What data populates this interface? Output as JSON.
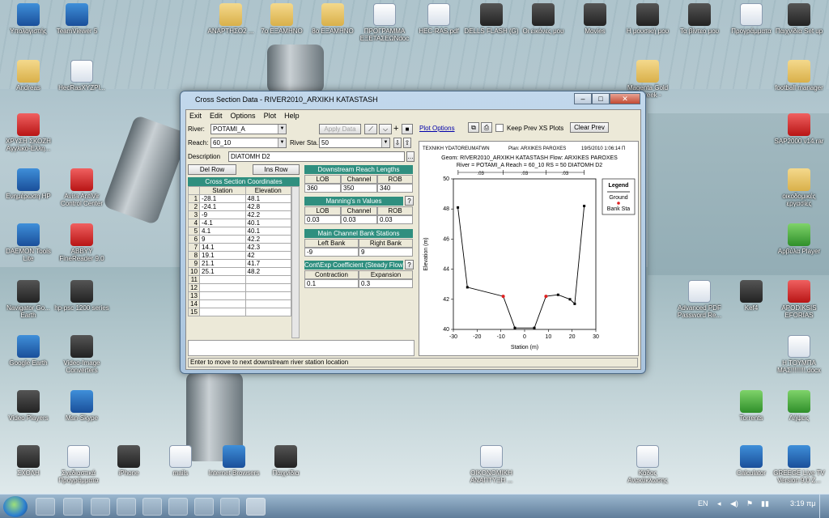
{
  "desktop": {
    "icons": [
      {
        "label": "Υπολογιστής"
      },
      {
        "label": "TeamViewer 5"
      },
      {
        "label": "ΑΝΑΡΤΗΣΟ2 ..."
      },
      {
        "label": "7ο ΕΞΑΜΗΝΟ"
      },
      {
        "label": "8ο ΕΞΑΜΗΝΟ"
      },
      {
        "label": "ΠΡΟΓΡΑΜΜΑ ΕΞΕΤΑΣΕΩΝdoc"
      },
      {
        "label": "HEC-RAS.pdf"
      },
      {
        "label": "DELLS FLASH (G)"
      },
      {
        "label": "Οι εικόνες μου"
      },
      {
        "label": "Movies"
      },
      {
        "label": "Η μουσική μου"
      },
      {
        "label": "Τα βίντεο μου"
      },
      {
        "label": "Προγράμματα"
      },
      {
        "label": "Παιχνίδια Set up"
      },
      {
        "label": "Andreas"
      },
      {
        "label": "HecRasXYZPl..."
      },
      {
        "label": "ΧΡΥΣΗ ΣΚΟΖΗ Αγγλικό-Ελλη..."
      },
      {
        "label": "Ενημέρωση HP"
      },
      {
        "label": "Avira AntiVir Control Center"
      },
      {
        "label": "DAEMON Tools Lite"
      },
      {
        "label": "ABBYY FineReader 9.0"
      },
      {
        "label": "Navigator Go... Earth"
      },
      {
        "label": "hp-psc 1200 series"
      },
      {
        "label": "Google Earth"
      },
      {
        "label": "Video-Image Converters"
      },
      {
        "label": "Video Players"
      },
      {
        "label": "Msn-Skype"
      },
      {
        "label": "ΣΧΟΛΗ"
      },
      {
        "label": "Σχεδιαστικά Προγράμματα"
      },
      {
        "label": "iPhone"
      },
      {
        "label": "mails"
      },
      {
        "label": "Internet Browsers"
      },
      {
        "label": "Παιχνίδια"
      },
      {
        "label": "ΟΙΚΟΝΟΜΙΚΗ ΑΝΑΠΤΥΞΗ ..."
      },
      {
        "label": "Κάδος Ανακύκλωσης"
      },
      {
        "label": "Calculator"
      },
      {
        "label": "GREEGE Live TV Version 9.0 Z..."
      },
      {
        "label": "football manager"
      },
      {
        "label": "SAP2000 v14.rar"
      },
      {
        "label": "οικοδομικές εργασίες"
      },
      {
        "label": "Αρβύλα Player"
      },
      {
        "label": "Advanced PDF Password Re..."
      },
      {
        "label": "Kef4"
      },
      {
        "label": "APODIKSIS EFORIAS"
      },
      {
        "label": "Η ΤΟΥΜΠΑ ΜΑΣ!!!!!!!!.docx"
      },
      {
        "label": "Torrents"
      },
      {
        "label": "Λήψεις"
      },
      {
        "label": "Magenta Gold ...Greek -"
      }
    ]
  },
  "window": {
    "title": "Cross Section Data - RIVER2010_ARXIKH KATASTASH",
    "menu": [
      "Exit",
      "Edit",
      "Options",
      "Plot",
      "Help"
    ],
    "river_label": "River:",
    "river_value": "POTAMI_A",
    "reach_label": "Reach:",
    "reach_value": "60_10",
    "river_sta_label": "River Sta.:",
    "river_sta_value": "50",
    "apply_data": "Apply Data",
    "description_label": "Description",
    "description_value": "DIATOMH D2",
    "del_row": "Del Row",
    "ins_row": "Ins Row",
    "xs_coords_title": "Cross Section Coordinates",
    "col_station": "Station",
    "col_elevation": "Elevation",
    "rows": [
      {
        "n": "1",
        "station": "-28.1",
        "elev": "48.1"
      },
      {
        "n": "2",
        "station": "-24.1",
        "elev": "42.8"
      },
      {
        "n": "3",
        "station": "-9",
        "elev": "42.2"
      },
      {
        "n": "4",
        "station": "-4.1",
        "elev": "40.1"
      },
      {
        "n": "5",
        "station": "4.1",
        "elev": "40.1"
      },
      {
        "n": "6",
        "station": "9",
        "elev": "42.2"
      },
      {
        "n": "7",
        "station": "14.1",
        "elev": "42.3"
      },
      {
        "n": "8",
        "station": "19.1",
        "elev": "42"
      },
      {
        "n": "9",
        "station": "21.1",
        "elev": "41.7"
      },
      {
        "n": "10",
        "station": "25.1",
        "elev": "48.2"
      },
      {
        "n": "11",
        "station": "",
        "elev": ""
      },
      {
        "n": "12",
        "station": "",
        "elev": ""
      },
      {
        "n": "13",
        "station": "",
        "elev": ""
      },
      {
        "n": "14",
        "station": "",
        "elev": ""
      },
      {
        "n": "15",
        "station": "",
        "elev": ""
      }
    ],
    "downstream": {
      "title": "Downstream Reach Lengths",
      "headers": [
        "LOB",
        "Channel",
        "ROB"
      ],
      "values": [
        "360",
        "350",
        "340"
      ]
    },
    "mannings": {
      "title": "Manning's n Values",
      "headers": [
        "LOB",
        "Channel",
        "ROB"
      ],
      "values": [
        "0.03",
        "0.03",
        "0.03"
      ]
    },
    "bank_stations": {
      "title": "Main Channel Bank Stations",
      "headers": [
        "Left Bank",
        "Right Bank"
      ],
      "values": [
        "-9",
        "9"
      ]
    },
    "coefficients": {
      "title": "Cont\\Exp Coefficient (Steady Flow)",
      "headers": [
        "Contraction",
        "Expansion"
      ],
      "values": [
        "0.1",
        "0.3"
      ]
    },
    "plot_options": "Plot Options",
    "keep_prev": "Keep Prev XS Plots",
    "clear_prev": "Clear Prev",
    "status": "Enter to move to next downstream river station location"
  },
  "chart_data": {
    "type": "line",
    "header_left": "TEXNIKH YDATOREUMATWN",
    "header_plan": "Plan: ARXIKES PAROXES",
    "header_date": "19/5/2010 1:06:14 Π",
    "title_line1": "Geom: RIVER2010_ARXIKH KATASTASH   Flow: ARXIKES PAROXES",
    "title_line2": "River = POTAMI_A   Reach = 60_10   RS = 50   DIATOMH D2",
    "n_values": [
      ".03",
      ".03",
      ".03"
    ],
    "xlabel": "Station (m)",
    "ylabel": "Elevation (m)",
    "xlim": [
      -30,
      30
    ],
    "ylim": [
      40,
      50
    ],
    "xticks": [
      "-30",
      "-20",
      "-10",
      "0",
      "10",
      "20",
      "30"
    ],
    "yticks": [
      "40",
      "42",
      "44",
      "46",
      "48",
      "50"
    ],
    "legend_title": "Legend",
    "series": [
      {
        "name": "Ground",
        "x": [
          -28.1,
          -24.1,
          -9,
          -4.1,
          4.1,
          9,
          14.1,
          19.1,
          21.1,
          25.1
        ],
        "y": [
          48.1,
          42.8,
          42.2,
          40.1,
          40.1,
          42.2,
          42.3,
          42,
          41.7,
          48.2
        ]
      },
      {
        "name": "Bank Sta",
        "x": [
          -9,
          9
        ],
        "y": [
          42.2,
          42.2
        ]
      }
    ],
    "colors": {
      "ground": "#000000",
      "bank": "#e02020"
    }
  },
  "taskbar": {
    "lang": "EN",
    "time": "3:19 πμ"
  }
}
